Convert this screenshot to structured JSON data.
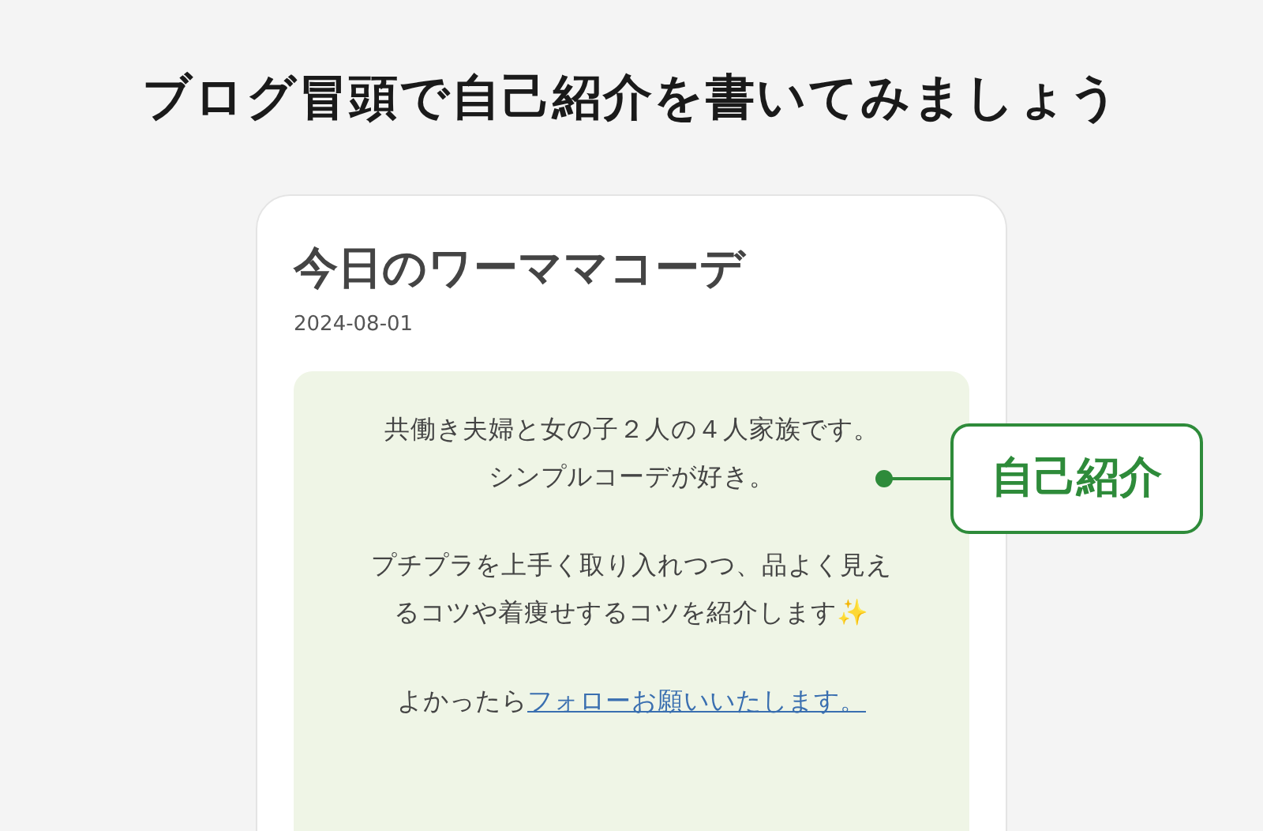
{
  "heading": "ブログ冒頭で自己紹介を書いてみましょう",
  "card": {
    "title": "今日のワーママコーデ",
    "date": "2024-08-01",
    "intro": {
      "paragraphs": [
        {
          "lines": [
            "共働き夫婦と女の子２人の４人家族です。",
            "シンプルコーデが好き。"
          ]
        },
        {
          "text": "プチプラを上手く取り入れつつ、品よく見えるコツや着痩せするコツを紹介します✨"
        },
        {
          "text": "よかったら",
          "link": "フォローお願いいたします。"
        }
      ]
    }
  },
  "callout": {
    "label": "自己紹介"
  }
}
